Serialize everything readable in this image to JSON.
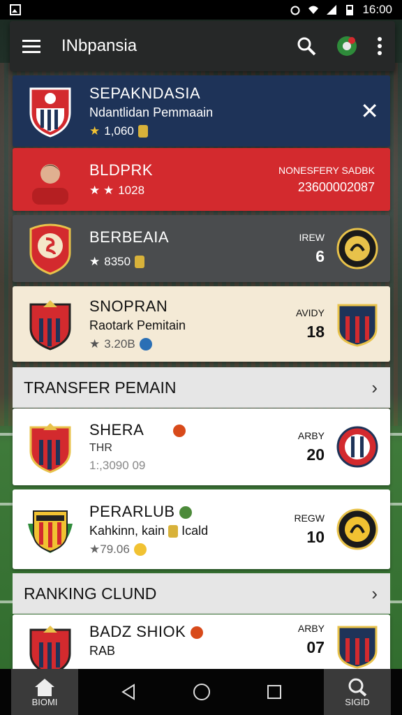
{
  "status_bar": {
    "time": "16:00"
  },
  "app_bar": {
    "title": "INbpansia"
  },
  "cards": [
    {
      "name": "SEPAKNDASIA",
      "subtitle": "Ndantlidan Pemmaain",
      "stat": "1,060",
      "stat_prefix": "★",
      "bg": "#1e3358",
      "fg": "#ffffff"
    },
    {
      "name": "BLDPRK",
      "stat": "1028",
      "stat_prefix": "★ ★",
      "right_label": "NONESFERY SADBK",
      "right_value": "23600002087",
      "bg": "#d32a2e",
      "fg": "#ffffff"
    },
    {
      "name": "BERBEAIA",
      "stat": "8350",
      "stat_prefix": "★",
      "right_label": "IREW",
      "right_value": "6",
      "bg": "#4a4c4e",
      "fg": "#ffffff"
    },
    {
      "name": "SNOPRAN",
      "subtitle": "Raotark Pemitain",
      "stat": "3.20B",
      "stat_prefix": "★",
      "right_label": "AVIDY",
      "right_value": "18",
      "bg": "#f4ead6",
      "fg": "#111111"
    }
  ],
  "sections": {
    "transfer": {
      "title": "TRANSFER  PEMAIN",
      "chevron": "›"
    },
    "ranking": {
      "title": "RANKING CLUND",
      "chevron": "›"
    }
  },
  "transfer_items": [
    {
      "name": "SHERA",
      "subtitle": "THR",
      "stat": "1:,3090 09",
      "right_label": "ARBY",
      "right_value": "20"
    },
    {
      "name": "PERARLUB",
      "subtitle": "Kahkinn, kain",
      "subtitle_tail": "Icald",
      "stat": "★79.06",
      "right_label": "REGW",
      "right_value": "10"
    }
  ],
  "ranking_items": [
    {
      "name": "BADZ SHIOK",
      "subtitle": "RAB",
      "right_label": "ARBY",
      "right_value": "07"
    }
  ],
  "bottom_nav": {
    "home_label": "BIOMI",
    "search_label": "SIGID"
  },
  "colors": {
    "accent_red": "#d32a2e",
    "navy": "#1e3358",
    "gold": "#d8b23a"
  }
}
